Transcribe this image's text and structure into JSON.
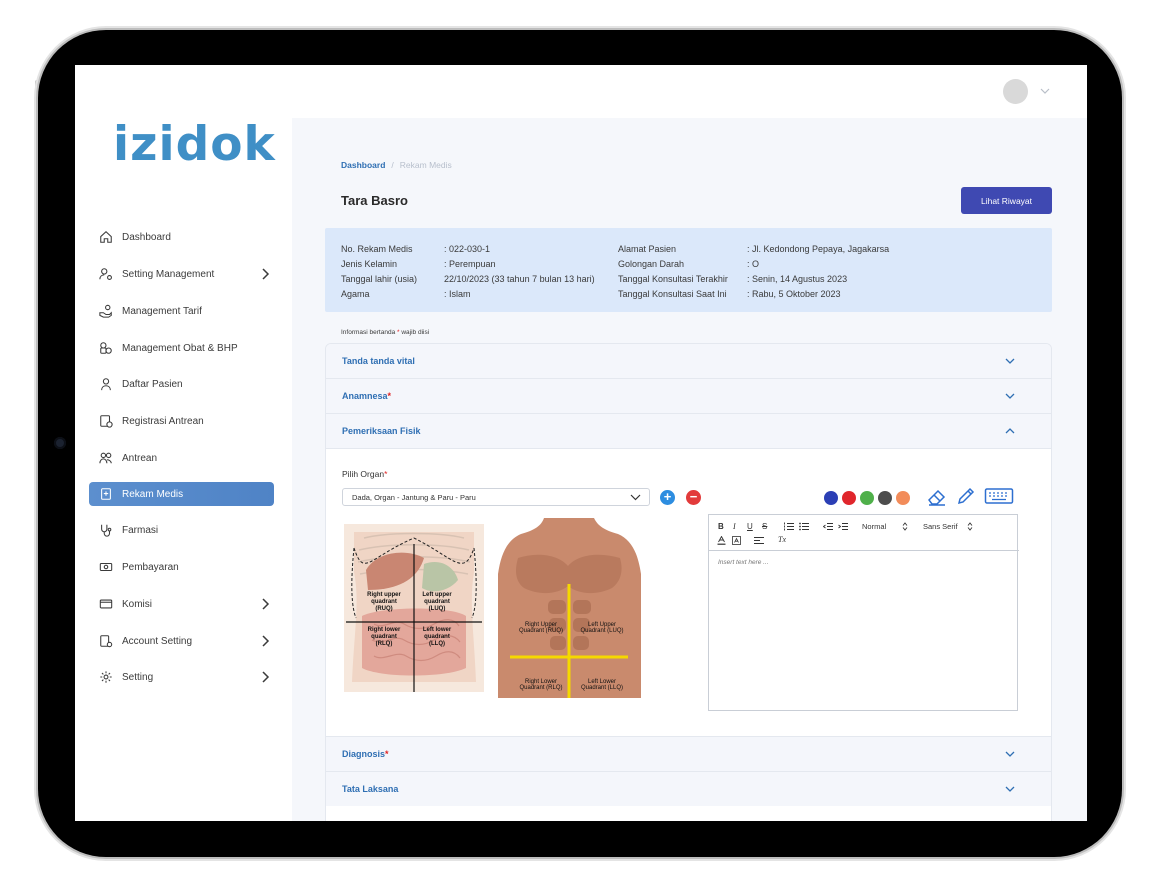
{
  "app": {
    "logo": "izidok"
  },
  "sidebar": {
    "items": [
      {
        "label": "Dashboard",
        "icon": "home-icon"
      },
      {
        "label": "Setting Management",
        "icon": "users-settings-icon",
        "has_submenu": true
      },
      {
        "label": "Management Tarif",
        "icon": "hand-coin-icon"
      },
      {
        "label": "Management Obat & BHP",
        "icon": "medicine-icon"
      },
      {
        "label": "Daftar Pasien",
        "icon": "user-icon"
      },
      {
        "label": "Registrasi Antrean",
        "icon": "clipboard-clock-icon"
      },
      {
        "label": "Antrean",
        "icon": "users-icon"
      },
      {
        "label": "Rekam Medis",
        "icon": "medical-record-icon",
        "active": true
      },
      {
        "label": "Farmasi",
        "icon": "stethoscope-icon"
      },
      {
        "label": "Pembayaran",
        "icon": "cash-icon"
      },
      {
        "label": "Komisi",
        "icon": "wallet-icon",
        "has_submenu": true
      },
      {
        "label": "Account Setting",
        "icon": "account-settings-icon",
        "has_submenu": true
      },
      {
        "label": "Setting",
        "icon": "gear-icon",
        "has_submenu": true
      }
    ]
  },
  "breadcrumb": {
    "root": "Dashboard",
    "separator": "/",
    "current": "Rekam Medis"
  },
  "patient": {
    "name": "Tara Basro",
    "history_button": "Lihat Riwayat",
    "left": [
      {
        "label": "No. Rekam Medis",
        "value": ": 022-030-1"
      },
      {
        "label": "Jenis Kelamin",
        "value": ": Perempuan"
      },
      {
        "label": "Tanggal lahir (usia)",
        "value": "22/10/2023 (33 tahun 7 bulan 13 hari)"
      },
      {
        "label": "Agama",
        "value": ": Islam"
      }
    ],
    "right": [
      {
        "label": "Alamat Pasien",
        "value": ": Jl. Kedondong Pepaya, Jagakarsa"
      },
      {
        "label": "Golongan Darah",
        "value": ": O"
      },
      {
        "label": "Tanggal Konsultasi Terakhir",
        "value": ": Senin, 14 Agustus 2023"
      },
      {
        "label": "Tanggal Konsultasi Saat Ini",
        "value": ": Rabu, 5 Oktober 2023"
      }
    ]
  },
  "form": {
    "required_note_prefix": "Informasi bertanda",
    "required_note_star": "*",
    "required_note_suffix": "wajib diisi",
    "sections": {
      "vital": {
        "title": "Tanda tanda vital",
        "required": false
      },
      "anamnesa": {
        "title": "Anamnesa",
        "required": true
      },
      "fisik": {
        "title": "Pemeriksaan Fisik",
        "required": false,
        "expanded": true
      },
      "diagnosis": {
        "title": "Diagnosis",
        "required": true
      },
      "tatalaksana": {
        "title": "Tata Laksana",
        "required": false
      }
    },
    "organ_label": "Pilih Organ",
    "organ_value": "Dada, Organ - Jantung & Paru - Paru",
    "plus_label": "+",
    "minus_label": "−",
    "palette": [
      "#2b3fb5",
      "#e0262c",
      "#4fb04a",
      "#4d4d4d",
      "#f28c5a"
    ],
    "tools": [
      "eraser-icon",
      "pencil-icon",
      "keyboard-icon"
    ],
    "anatomy_left_labels": {
      "ruq": [
        "Right upper",
        "quadrant",
        "(RUQ)"
      ],
      "luq": [
        "Left upper",
        "quadrant",
        "(LUQ)"
      ],
      "rlq": [
        "Right lower",
        "quadrant",
        "(RLQ)"
      ],
      "llq": [
        "Left lower",
        "quadrant",
        "(LLQ)"
      ]
    },
    "anatomy_right_labels": {
      "ruq": [
        "Right Upper",
        "Quadrant (RUQ)"
      ],
      "luq": [
        "Left Upper",
        "Quadrant (LUQ)"
      ],
      "rlq": [
        "Right Lower",
        "Quadrant (RLQ)"
      ],
      "llq": [
        "Left Lower",
        "Quadrant (LLQ)"
      ]
    },
    "editor": {
      "bold": "B",
      "italic": "I",
      "underline": "U",
      "strike": "S",
      "heading": "Normal",
      "font": "Sans Serif",
      "clear": "Tx",
      "placeholder": "Insert text here ..."
    }
  }
}
